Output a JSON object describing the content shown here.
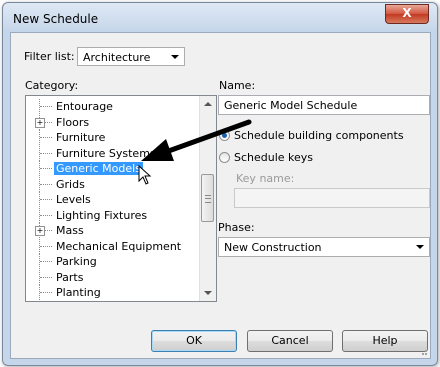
{
  "window": {
    "title": "New Schedule",
    "close_label": "X"
  },
  "filter": {
    "label": "Filter list:",
    "value": "Architecture"
  },
  "category": {
    "label": "Category:",
    "items": [
      {
        "label": "Entourage",
        "expandable": false
      },
      {
        "label": "Floors",
        "expandable": true
      },
      {
        "label": "Furniture",
        "expandable": false
      },
      {
        "label": "Furniture Systems",
        "expandable": false
      },
      {
        "label": "Generic Models",
        "expandable": false,
        "selected": true
      },
      {
        "label": "Grids",
        "expandable": false
      },
      {
        "label": "Levels",
        "expandable": false
      },
      {
        "label": "Lighting Fixtures",
        "expandable": false
      },
      {
        "label": "Mass",
        "expandable": true
      },
      {
        "label": "Mechanical Equipment",
        "expandable": false
      },
      {
        "label": "Parking",
        "expandable": false
      },
      {
        "label": "Parts",
        "expandable": false
      },
      {
        "label": "Planting",
        "expandable": false
      }
    ]
  },
  "name": {
    "label": "Name:",
    "value": "Generic Model Schedule"
  },
  "options": {
    "building_components": "Schedule building components",
    "schedule_keys": "Schedule keys",
    "selected": "building_components"
  },
  "key_name": {
    "label": "Key name:",
    "value": ""
  },
  "phase": {
    "label": "Phase:",
    "value": "New Construction"
  },
  "buttons": {
    "ok": "OK",
    "cancel": "Cancel",
    "help": "Help"
  },
  "colors": {
    "selection": "#3399ff",
    "radio_dot": "#1c5fb0",
    "close_button": "#c13a22",
    "annotation_arrow": "#000000"
  },
  "icons": {
    "close": "close-icon",
    "annotation": "arrow-annotation-icon",
    "cursor": "mouse-cursor-icon"
  }
}
